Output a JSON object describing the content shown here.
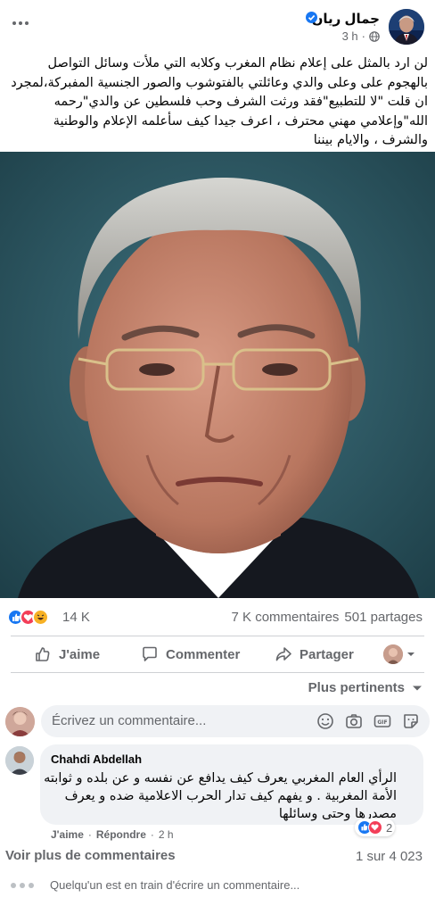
{
  "post": {
    "author": "جمال ريان",
    "time": "3 h",
    "text": "لن ارد بالمثل على إعلام نظام المغرب وكلابه التي ملأت وسائل التواصل بالهجوم على وعلى والدي وعائلتي بالفتوشوب والصور الجنسية المفبركة،لمجرد ان قلت \"لا للتطبيع\"فقد ورثت الشرف وحب فلسطين عن والدي\"رحمه الله\"وإعلامي مهني محترف ، اعرف جيدا كيف سأعلمه الإعلام والوطنية والشرف ، والايام بيننا"
  },
  "stats": {
    "reactions": "14 K",
    "comments": "7 K commentaires",
    "shares": "501 partages"
  },
  "actions": {
    "like": "J'aime",
    "comment": "Commenter",
    "share": "Partager"
  },
  "sort_label": "Plus pertinents",
  "composer": {
    "placeholder": "Écrivez un commentaire..."
  },
  "comment": {
    "author": "Chahdi Abdellah",
    "text": "الرأي العام المغربي يعرف كيف يدافع عن نفسه و عن بلده و ثوابته الأمة المغربية . و يفهم كيف تدار الحرب الاعلامية ضده و يعرف مصدرها وحتى وسائلها",
    "like": "J'aime",
    "reply": "Répondre",
    "time": "2 h",
    "reaction_count": "2"
  },
  "footer": {
    "more_comments": "Voir plus de commentaires",
    "pager": "1 sur 4 023",
    "typing": "Quelqu'un est en train d'écrire un commentaire..."
  },
  "colors": {
    "like_blue": "#1877f2",
    "love_red": "#f33e58",
    "haha_yellow": "#f7b125",
    "secondary_text": "#65676b",
    "bubble_bg": "#f0f2f5"
  }
}
